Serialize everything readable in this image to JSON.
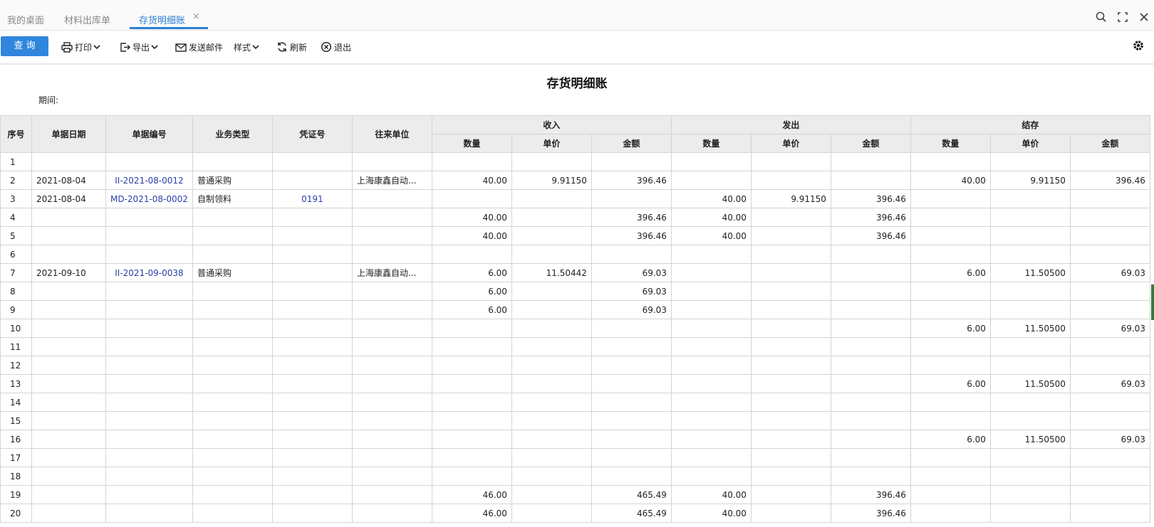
{
  "tabs": [
    {
      "label": "我的桌面",
      "active": false
    },
    {
      "label": "材料出库单",
      "active": false
    },
    {
      "label": "存货明细账",
      "active": true
    }
  ],
  "toolbar": {
    "query": "查 询",
    "print": "打印",
    "export": "导出",
    "send_mail": "发送邮件",
    "style": "样式",
    "refresh": "刷新",
    "exit": "退出"
  },
  "report": {
    "title": "存货明细账",
    "period_label": "期间:"
  },
  "columns": {
    "seq": "序号",
    "date": "单据日期",
    "doc_no": "单据编号",
    "biz_type": "业务类型",
    "voucher": "凭证号",
    "partner": "往来单位",
    "in_group": "收入",
    "out_group": "发出",
    "bal_group": "结存",
    "qty": "数量",
    "price": "单价",
    "amount": "金额"
  },
  "rows": [
    [
      "1",
      "",
      "",
      "",
      "",
      "",
      "",
      "",
      "",
      "",
      "",
      "",
      "",
      "",
      ""
    ],
    [
      "2",
      "2021-08-04",
      "II-2021-08-0012",
      "普通采购",
      "",
      "上海康鑫自动...",
      "40.00",
      "9.91150",
      "396.46",
      "",
      "",
      "",
      "40.00",
      "9.91150",
      "396.46"
    ],
    [
      "3",
      "2021-08-04",
      "MD-2021-08-0002",
      "自制领料",
      "0191",
      "",
      "",
      "",
      "",
      "40.00",
      "9.91150",
      "396.46",
      "",
      "",
      ""
    ],
    [
      "4",
      "",
      "",
      "",
      "",
      "",
      "40.00",
      "",
      "396.46",
      "40.00",
      "",
      "396.46",
      "",
      "",
      ""
    ],
    [
      "5",
      "",
      "",
      "",
      "",
      "",
      "40.00",
      "",
      "396.46",
      "40.00",
      "",
      "396.46",
      "",
      "",
      ""
    ],
    [
      "6",
      "",
      "",
      "",
      "",
      "",
      "",
      "",
      "",
      "",
      "",
      "",
      "",
      "",
      ""
    ],
    [
      "7",
      "2021-09-10",
      "II-2021-09-0038",
      "普通采购",
      "",
      "上海康鑫自动...",
      "6.00",
      "11.50442",
      "69.03",
      "",
      "",
      "",
      "6.00",
      "11.50500",
      "69.03"
    ],
    [
      "8",
      "",
      "",
      "",
      "",
      "",
      "6.00",
      "",
      "69.03",
      "",
      "",
      "",
      "",
      "",
      ""
    ],
    [
      "9",
      "",
      "",
      "",
      "",
      "",
      "6.00",
      "",
      "69.03",
      "",
      "",
      "",
      "",
      "",
      ""
    ],
    [
      "10",
      "",
      "",
      "",
      "",
      "",
      "",
      "",
      "",
      "",
      "",
      "",
      "6.00",
      "11.50500",
      "69.03"
    ],
    [
      "11",
      "",
      "",
      "",
      "",
      "",
      "",
      "",
      "",
      "",
      "",
      "",
      "",
      "",
      ""
    ],
    [
      "12",
      "",
      "",
      "",
      "",
      "",
      "",
      "",
      "",
      "",
      "",
      "",
      "",
      "",
      ""
    ],
    [
      "13",
      "",
      "",
      "",
      "",
      "",
      "",
      "",
      "",
      "",
      "",
      "",
      "6.00",
      "11.50500",
      "69.03"
    ],
    [
      "14",
      "",
      "",
      "",
      "",
      "",
      "",
      "",
      "",
      "",
      "",
      "",
      "",
      "",
      ""
    ],
    [
      "15",
      "",
      "",
      "",
      "",
      "",
      "",
      "",
      "",
      "",
      "",
      "",
      "",
      "",
      ""
    ],
    [
      "16",
      "",
      "",
      "",
      "",
      "",
      "",
      "",
      "",
      "",
      "",
      "",
      "6.00",
      "11.50500",
      "69.03"
    ],
    [
      "17",
      "",
      "",
      "",
      "",
      "",
      "",
      "",
      "",
      "",
      "",
      "",
      "",
      "",
      ""
    ],
    [
      "18",
      "",
      "",
      "",
      "",
      "",
      "",
      "",
      "",
      "",
      "",
      "",
      "",
      "",
      ""
    ],
    [
      "19",
      "",
      "",
      "",
      "",
      "",
      "46.00",
      "",
      "465.49",
      "40.00",
      "",
      "396.46",
      "",
      "",
      ""
    ],
    [
      "20",
      "",
      "",
      "",
      "",
      "",
      "46.00",
      "",
      "465.49",
      "40.00",
      "",
      "396.46",
      "",
      "",
      ""
    ]
  ],
  "colors": {
    "accent": "#2f86dc",
    "link": "#2a3fa8",
    "header_bg": "#ececec"
  }
}
